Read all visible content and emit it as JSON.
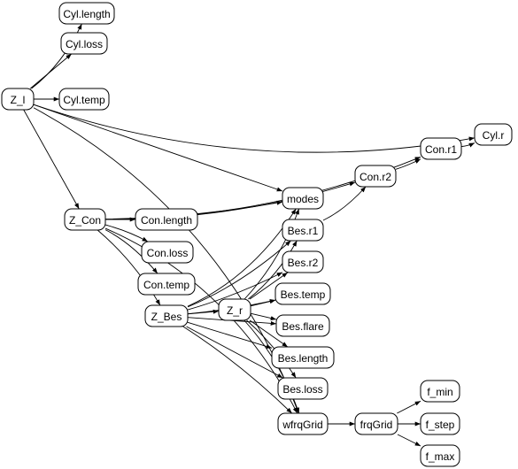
{
  "nodes": [
    {
      "id": "Z_l",
      "label": "Z_l"
    },
    {
      "id": "Cyl.length",
      "label": "Cyl.length"
    },
    {
      "id": "Cyl.loss",
      "label": "Cyl.loss"
    },
    {
      "id": "Cyl.temp",
      "label": "Cyl.temp"
    },
    {
      "id": "Cyl.r",
      "label": "Cyl.r"
    },
    {
      "id": "Con.r1",
      "label": "Con.r1"
    },
    {
      "id": "Con.r2",
      "label": "Con.r2"
    },
    {
      "id": "modes",
      "label": "modes"
    },
    {
      "id": "Z_Con",
      "label": "Z_Con"
    },
    {
      "id": "Con.length",
      "label": "Con.length"
    },
    {
      "id": "Con.loss",
      "label": "Con.loss"
    },
    {
      "id": "Con.temp",
      "label": "Con.temp"
    },
    {
      "id": "Bes.r1",
      "label": "Bes.r1"
    },
    {
      "id": "Bes.r2",
      "label": "Bes.r2"
    },
    {
      "id": "Z_Bes",
      "label": "Z_Bes"
    },
    {
      "id": "Z_r",
      "label": "Z_r"
    },
    {
      "id": "Bes.temp",
      "label": "Bes.temp"
    },
    {
      "id": "Bes.flare",
      "label": "Bes.flare"
    },
    {
      "id": "Bes.length",
      "label": "Bes.length"
    },
    {
      "id": "Bes.loss",
      "label": "Bes.loss"
    },
    {
      "id": "wfrqGrid",
      "label": "wfrqGrid"
    },
    {
      "id": "frqGrid",
      "label": "frqGrid"
    },
    {
      "id": "f_min",
      "label": "f_min"
    },
    {
      "id": "f_step",
      "label": "f_step"
    },
    {
      "id": "f_max",
      "label": "f_max"
    }
  ],
  "edges": [
    [
      "Z_l",
      "Cyl.length"
    ],
    [
      "Z_l",
      "Cyl.loss"
    ],
    [
      "Z_l",
      "Cyl.temp"
    ],
    [
      "Z_l",
      "Cyl.r"
    ],
    [
      "Z_l",
      "modes"
    ],
    [
      "Z_l",
      "Z_Con"
    ],
    [
      "Z_l",
      "wfrqGrid"
    ],
    [
      "Z_Con",
      "Con.length"
    ],
    [
      "Z_Con",
      "Con.loss"
    ],
    [
      "Z_Con",
      "Con.temp"
    ],
    [
      "Z_Con",
      "Z_Bes"
    ],
    [
      "Z_Con",
      "Con.r1"
    ],
    [
      "Z_Con",
      "Con.r2"
    ],
    [
      "Z_Con",
      "modes"
    ],
    [
      "Z_Con",
      "wfrqGrid"
    ],
    [
      "Con.r1",
      "Cyl.r"
    ],
    [
      "Con.r2",
      "Con.r1"
    ],
    [
      "Bes.r1",
      "Con.r2"
    ],
    [
      "Z_Bes",
      "Z_r"
    ],
    [
      "Z_Bes",
      "modes"
    ],
    [
      "Z_Bes",
      "Bes.r1"
    ],
    [
      "Z_Bes",
      "Bes.r2"
    ],
    [
      "Z_Bes",
      "Bes.temp"
    ],
    [
      "Z_Bes",
      "Bes.flare"
    ],
    [
      "Z_Bes",
      "Bes.length"
    ],
    [
      "Z_Bes",
      "Bes.loss"
    ],
    [
      "Z_Bes",
      "wfrqGrid"
    ],
    [
      "Z_r",
      "modes"
    ],
    [
      "Z_r",
      "Bes.r1"
    ],
    [
      "Z_r",
      "Bes.r2"
    ],
    [
      "Z_r",
      "Bes.temp"
    ],
    [
      "Z_r",
      "Bes.flare"
    ],
    [
      "Z_r",
      "Bes.length"
    ],
    [
      "Z_r",
      "Bes.loss"
    ],
    [
      "Z_r",
      "wfrqGrid"
    ],
    [
      "wfrqGrid",
      "frqGrid"
    ],
    [
      "frqGrid",
      "f_min"
    ],
    [
      "frqGrid",
      "f_step"
    ],
    [
      "frqGrid",
      "f_max"
    ]
  ]
}
